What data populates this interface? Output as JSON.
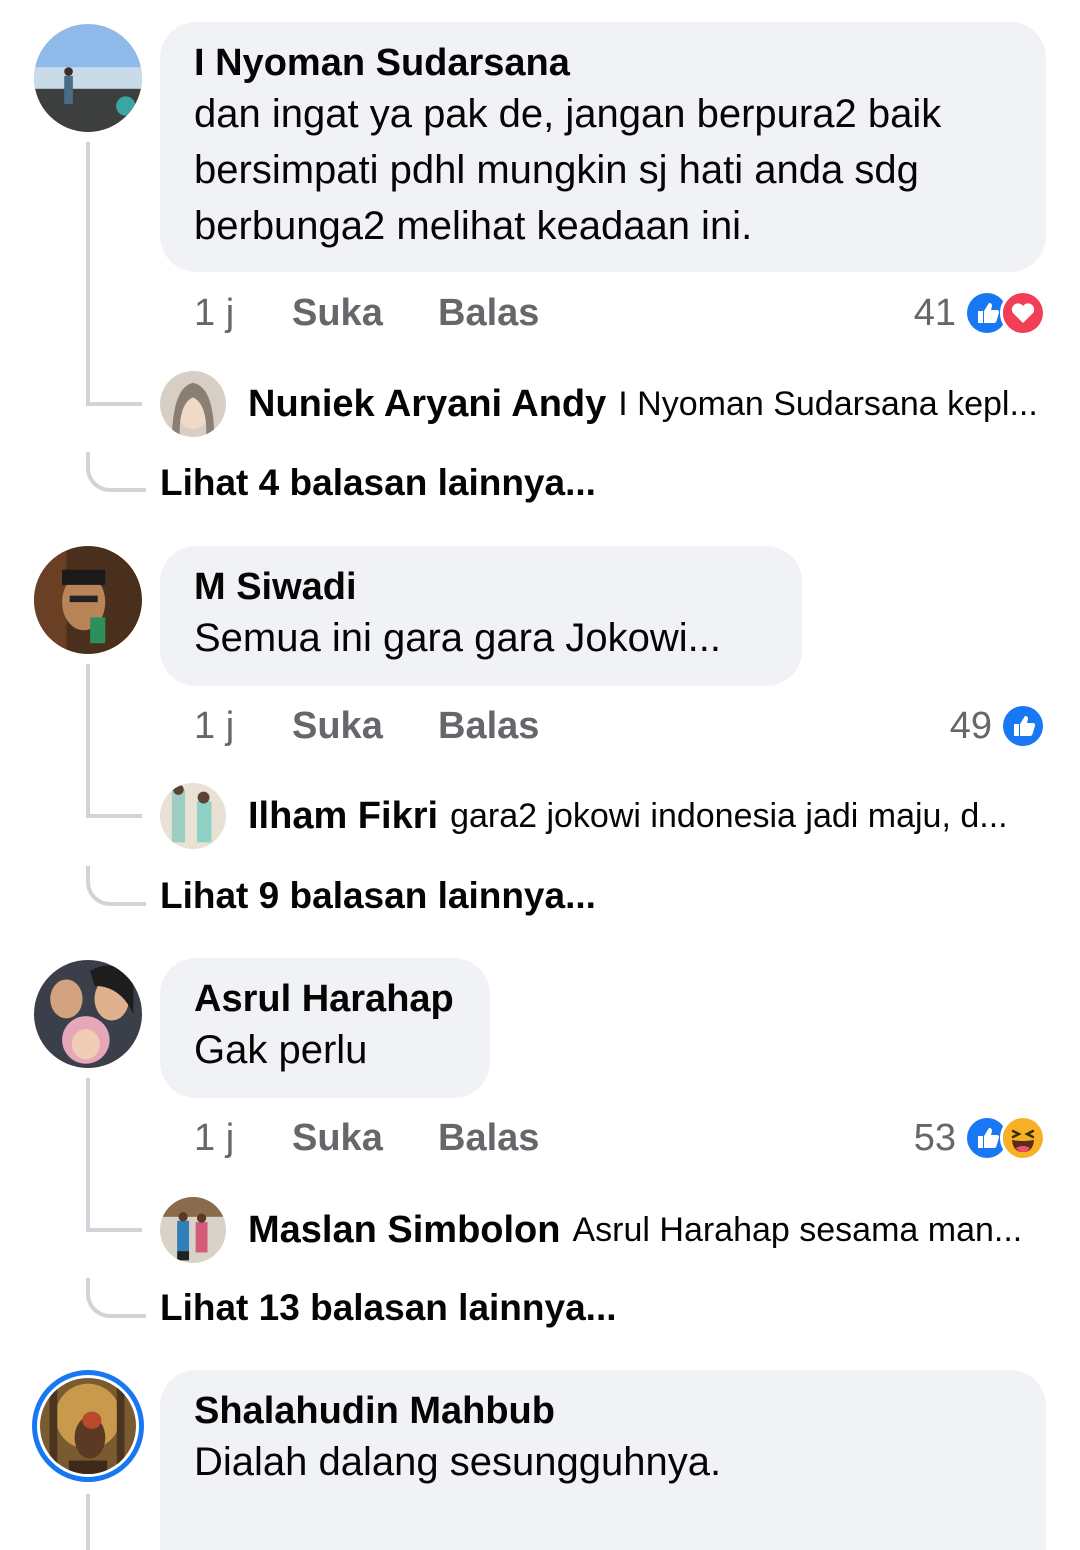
{
  "comments": [
    {
      "author": "I Nyoman Sudarsana",
      "lines": [
        "dan ingat ya pak de, jangan berpura2 baik",
        "bersimpati pdhl mungkin sj hati anda sdg",
        "berbunga2 melihat keadaan ini."
      ],
      "time": "1 j",
      "like_label": "Suka",
      "reply_label": "Balas",
      "reaction_count": "41",
      "reactions": [
        "like-icon",
        "love-icon"
      ],
      "reply_preview": {
        "name": "Nuniek Aryani Andy",
        "snippet": "I Nyoman Sudarsana kepl..."
      },
      "more_replies": "Lihat 4 balasan lainnya..."
    },
    {
      "author": "M Siwadi",
      "lines": [
        "Semua ini gara gara Jokowi..."
      ],
      "time": "1 j",
      "like_label": "Suka",
      "reply_label": "Balas",
      "reaction_count": "49",
      "reactions": [
        "like-icon"
      ],
      "reply_preview": {
        "name": "Ilham Fikri",
        "snippet": "gara2 jokowi indonesia jadi maju, d..."
      },
      "more_replies": "Lihat 9 balasan lainnya..."
    },
    {
      "author": "Asrul Harahap",
      "lines": [
        "Gak perlu"
      ],
      "time": "1 j",
      "like_label": "Suka",
      "reply_label": "Balas",
      "reaction_count": "53",
      "reactions": [
        "like-icon",
        "haha-icon"
      ],
      "reply_preview": {
        "name": "Maslan Simbolon",
        "snippet": "Asrul Harahap sesama man..."
      },
      "more_replies": "Lihat 13 balasan lainnya..."
    },
    {
      "author": "Shalahudin Mahbub",
      "lines": [
        "Dialah dalang sesungguhnya."
      ]
    }
  ],
  "colors": {
    "like": "#1877f2",
    "love": "#f33e58",
    "haha": "#f7b125",
    "thread_line": "#d0d3d8",
    "bubble": "#f0f2f5",
    "meta": "#65676b"
  }
}
